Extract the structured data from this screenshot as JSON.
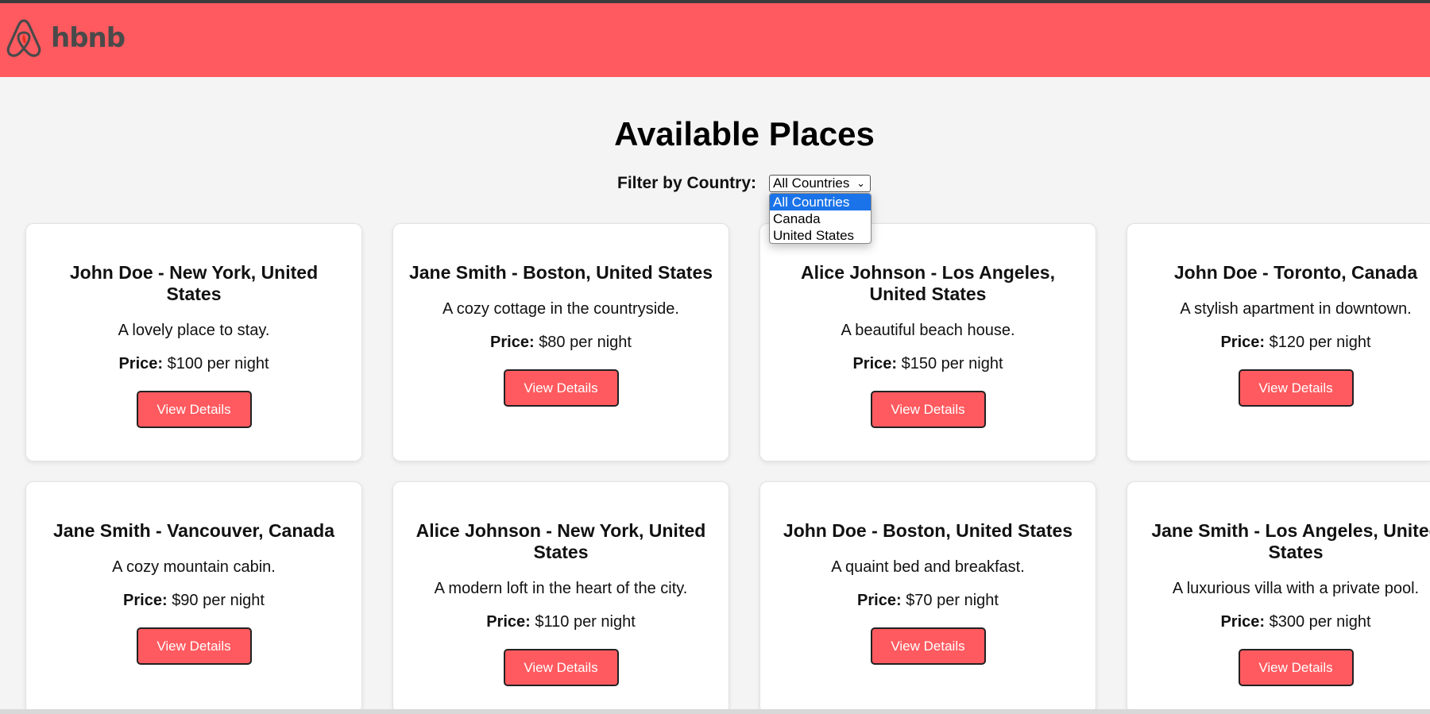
{
  "header": {
    "logo_text": "hbnb",
    "brand_color": "#ff5a5f"
  },
  "main": {
    "title": "Available Places",
    "filter": {
      "label": "Filter by Country:",
      "selected": "All Countries",
      "options": [
        "All Countries",
        "Canada",
        "United States"
      ]
    }
  },
  "places": [
    {
      "title": "John Doe - New York, United States",
      "description": "A lovely place to stay.",
      "price_label": "Price:",
      "price_text": "$100 per night",
      "button": "View Details"
    },
    {
      "title": "Jane Smith - Boston, United States",
      "description": "A cozy cottage in the countryside.",
      "price_label": "Price:",
      "price_text": "$80 per night",
      "button": "View Details"
    },
    {
      "title": "Alice Johnson - Los Angeles, United States",
      "description": "A beautiful beach house.",
      "price_label": "Price:",
      "price_text": "$150 per night",
      "button": "View Details"
    },
    {
      "title": "John Doe - Toronto, Canada",
      "description": "A stylish apartment in downtown.",
      "price_label": "Price:",
      "price_text": "$120 per night",
      "button": "View Details"
    },
    {
      "title": "Jane Smith - Vancouver, Canada",
      "description": "A cozy mountain cabin.",
      "price_label": "Price:",
      "price_text": "$90 per night",
      "button": "View Details"
    },
    {
      "title": "Alice Johnson - New York, United States",
      "description": "A modern loft in the heart of the city.",
      "price_label": "Price:",
      "price_text": "$110 per night",
      "button": "View Details"
    },
    {
      "title": "John Doe - Boston, United States",
      "description": "A quaint bed and breakfast.",
      "price_label": "Price:",
      "price_text": "$70 per night",
      "button": "View Details"
    },
    {
      "title": "Jane Smith - Los Angeles, United States",
      "description": "A luxurious villa with a private pool.",
      "price_label": "Price:",
      "price_text": "$300 per night",
      "button": "View Details"
    }
  ]
}
